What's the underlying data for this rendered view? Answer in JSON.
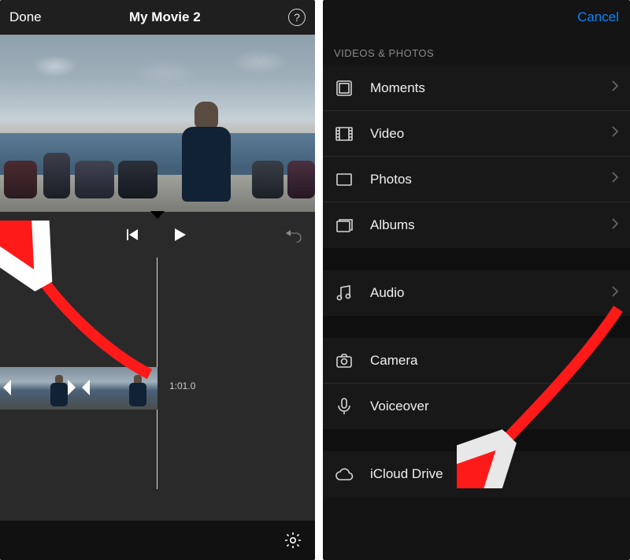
{
  "editor": {
    "done_label": "Done",
    "title": "My Movie 2",
    "help_label": "?",
    "timecode": "1:01.0"
  },
  "media_menu": {
    "cancel_label": "Cancel",
    "section_label": "VIDEOS & PHOTOS",
    "items": {
      "moments": {
        "label": "Moments"
      },
      "video": {
        "label": "Video"
      },
      "photos": {
        "label": "Photos"
      },
      "albums": {
        "label": "Albums"
      },
      "audio": {
        "label": "Audio"
      },
      "camera": {
        "label": "Camera"
      },
      "voiceover": {
        "label": "Voiceover"
      },
      "icloud": {
        "label": "iCloud Drive"
      }
    }
  }
}
